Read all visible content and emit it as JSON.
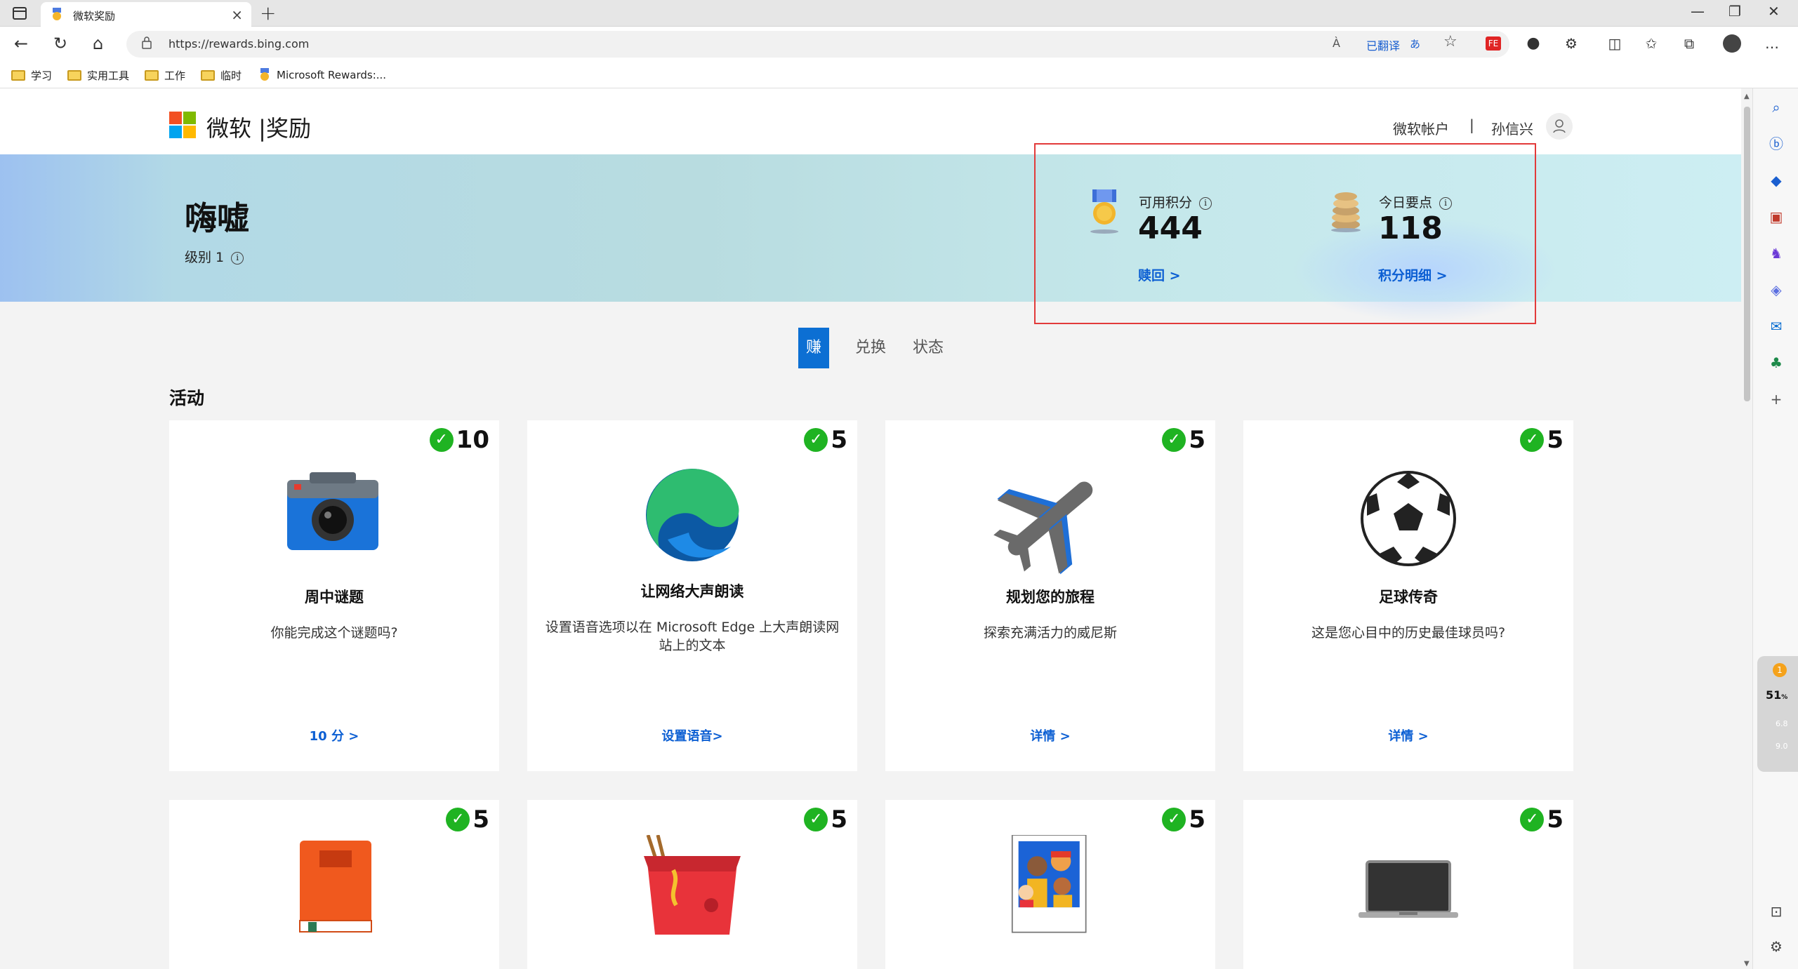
{
  "browser": {
    "tab_title": "微软奖励",
    "tab_close": "×",
    "new_tab": "+",
    "url": "https://rewards.bing.com",
    "read_aloud": "À",
    "translated": "已翻译",
    "translate_icon": "あ"
  },
  "bookmarks": [
    {
      "label": "学习"
    },
    {
      "label": "实用工具"
    },
    {
      "label": "工作"
    },
    {
      "label": "临时"
    },
    {
      "label": "Microsoft Rewards:..."
    }
  ],
  "header": {
    "brand": "微软 |奖励",
    "account": "微软帐户",
    "separator": "|",
    "user_name": "孙信兴"
  },
  "banner": {
    "greeting": "嗨嘘",
    "level": "级别 1",
    "available_label": "可用积分",
    "available_value": "444",
    "redeem_link": "赎回 >",
    "today_label": "今日要点",
    "today_value": "118",
    "detail_link": "积分明细 >"
  },
  "tabs": [
    "赚",
    "兑换",
    "状态"
  ],
  "activities_title": "活动",
  "activities": [
    {
      "points": "10",
      "title": "周中谜题",
      "desc": "你能完成这个谜题吗?",
      "link": "10 分 >",
      "icon": "camera-icon"
    },
    {
      "points": "5",
      "title": "让网络大声朗读",
      "desc": "设置语音选项以在 Microsoft Edge 上大声朗读网站上的文本",
      "link": "设置语音>",
      "icon": "edge-logo-icon"
    },
    {
      "points": "5",
      "title": "规划您的旅程",
      "desc": "探索充满活力的威尼斯",
      "link": "详情 >",
      "icon": "airplane-icon"
    },
    {
      "points": "5",
      "title": "足球传奇",
      "desc": "这是您心目中的历史最佳球员吗?",
      "link": "详情 >",
      "icon": "soccer-ball-icon"
    }
  ],
  "activities_row2": [
    {
      "points": "5",
      "icon": "book-icon"
    },
    {
      "points": "5",
      "icon": "takeout-box-icon"
    },
    {
      "points": "5",
      "icon": "family-photo-icon"
    },
    {
      "points": "5",
      "icon": "laptop-icon"
    }
  ],
  "widget": {
    "alert": "1",
    "cpu": "51",
    "cpu_unit": "%",
    "up": "6.8",
    "down": "9.0"
  },
  "colors": {
    "accent": "#0c6fd3",
    "check": "#1fb322",
    "highlight": "#e23a3a"
  }
}
